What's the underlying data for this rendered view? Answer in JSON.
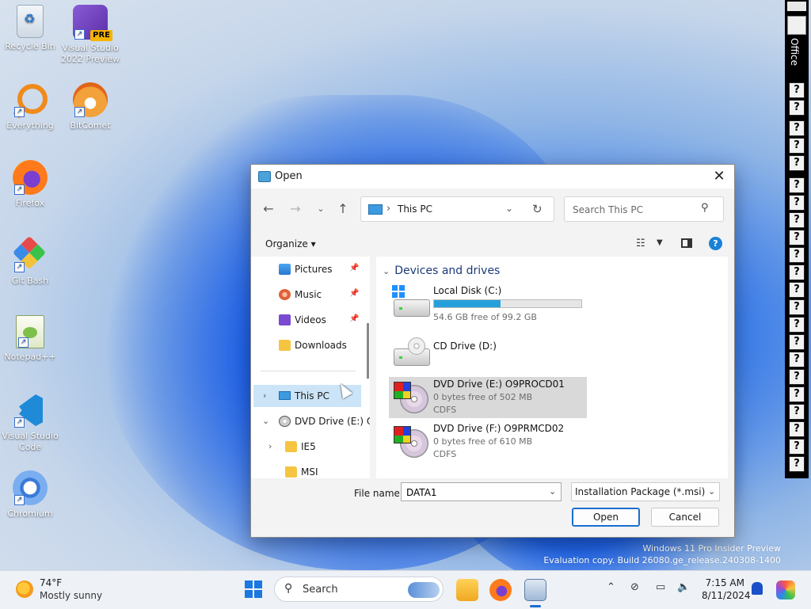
{
  "desktop": {
    "icons": [
      {
        "label": "Recycle Bin"
      },
      {
        "label": "Visual Studio 2022 Preview",
        "badge": "PRE"
      },
      {
        "label": "Everything"
      },
      {
        "label": "BitComet"
      },
      {
        "label": "Firefox"
      },
      {
        "label": "Git Bash"
      },
      {
        "label": "Notepad++"
      },
      {
        "label": "Visual Studio Code"
      },
      {
        "label": "Chromium"
      }
    ],
    "watermark": {
      "line1": "Windows 11 Pro Insider Preview",
      "line2": "Evaluation copy. Build 26080.ge_release.240308-1400"
    }
  },
  "office_bar": {
    "label": "Office",
    "button_glyph": "?"
  },
  "dialog": {
    "title": "Open",
    "close_glyph": "✕",
    "address": {
      "separator": "›",
      "location": "This PC"
    },
    "search": {
      "placeholder": "Search This PC"
    },
    "organize_label": "Organize ▾",
    "help_glyph": "?",
    "nav": [
      {
        "label": "Pictures",
        "pinned": true
      },
      {
        "label": "Music",
        "pinned": true
      },
      {
        "label": "Videos",
        "pinned": true
      },
      {
        "label": "Downloads",
        "pinned": false
      },
      {
        "label": "This PC",
        "selected": true
      },
      {
        "label": "DVD Drive (E:) O"
      },
      {
        "label": "IE5"
      },
      {
        "label": "MSI"
      }
    ],
    "group_label": "Devices and drives",
    "drives": [
      {
        "name": "Local Disk (C:)",
        "free_text": "54.6 GB free of 99.2 GB",
        "used_fraction": 0.45
      },
      {
        "name": "CD Drive (D:)"
      },
      {
        "name": "DVD Drive (E:) O9PROCD01",
        "free_text": "0 bytes free of 502 MB",
        "fs": "CDFS",
        "selected": true
      },
      {
        "name": "DVD Drive (F:) O9PRMCD02",
        "free_text": "0 bytes free of 610 MB",
        "fs": "CDFS"
      }
    ],
    "file_name_label": "File name:",
    "file_name_value": "DATA1",
    "file_type": "Installation Package (*.msi)",
    "open_label": "Open",
    "cancel_label": "Cancel"
  },
  "taskbar": {
    "weather": {
      "temp": "74°F",
      "desc": "Mostly sunny"
    },
    "search_label": "Search",
    "time": "7:15 AM",
    "date": "8/11/2024"
  },
  "colors": {
    "accent": "#1a6ed0",
    "progress": "#26a0da",
    "selection": "#cce4f7"
  }
}
